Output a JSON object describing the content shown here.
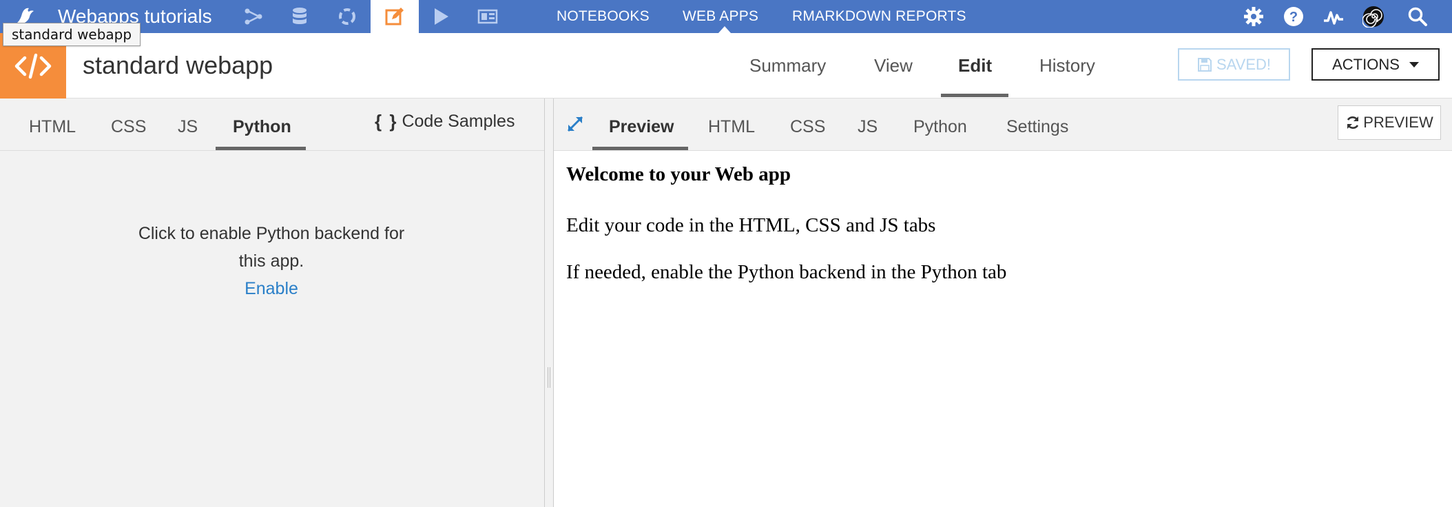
{
  "topnav": {
    "project": "Webapps tutorials",
    "links": {
      "notebooks": "NOTEBOOKS",
      "webapps": "WEB APPS",
      "rmarkdown": "RMARKDOWN REPORTS"
    },
    "icons": [
      "bird-logo-icon",
      "flow-icon",
      "datasets-icon",
      "lab-icon",
      "code-icon",
      "jobs-icon",
      "dashboard-icon",
      "settings-icon",
      "help-icon",
      "activity-icon",
      "spiral-icon",
      "search-icon"
    ],
    "bg_color": "#4a76c4",
    "accent_color": "#f58d3b"
  },
  "tooltip": {
    "text": "standard webapp"
  },
  "header": {
    "title": "standard webapp",
    "tabs": {
      "summary": "Summary",
      "view": "View",
      "edit": "Edit",
      "history": "History"
    },
    "active_tab": "Edit",
    "saved_label": "SAVED!",
    "actions_label": "ACTIONS"
  },
  "editor": {
    "tabs": {
      "html": "HTML",
      "css": "CSS",
      "js": "JS",
      "python": "Python"
    },
    "active_tab": "Python",
    "code_samples_braces": "{ }",
    "code_samples_label": "Code Samples",
    "enable_message": "Click to enable Python backend for this app.",
    "enable_link": "Enable",
    "link_color": "#2a7fc8"
  },
  "preview_pane": {
    "tabs": {
      "preview": "Preview",
      "html": "HTML",
      "css": "CSS",
      "js": "JS",
      "python": "Python",
      "settings": "Settings"
    },
    "active_tab": "Preview",
    "preview_button": "PREVIEW",
    "content": {
      "heading": "Welcome to your Web app",
      "para1": "Edit your code in the HTML, CSS and JS tabs",
      "para2": "If needed, enable the Python backend in the Python tab"
    }
  }
}
